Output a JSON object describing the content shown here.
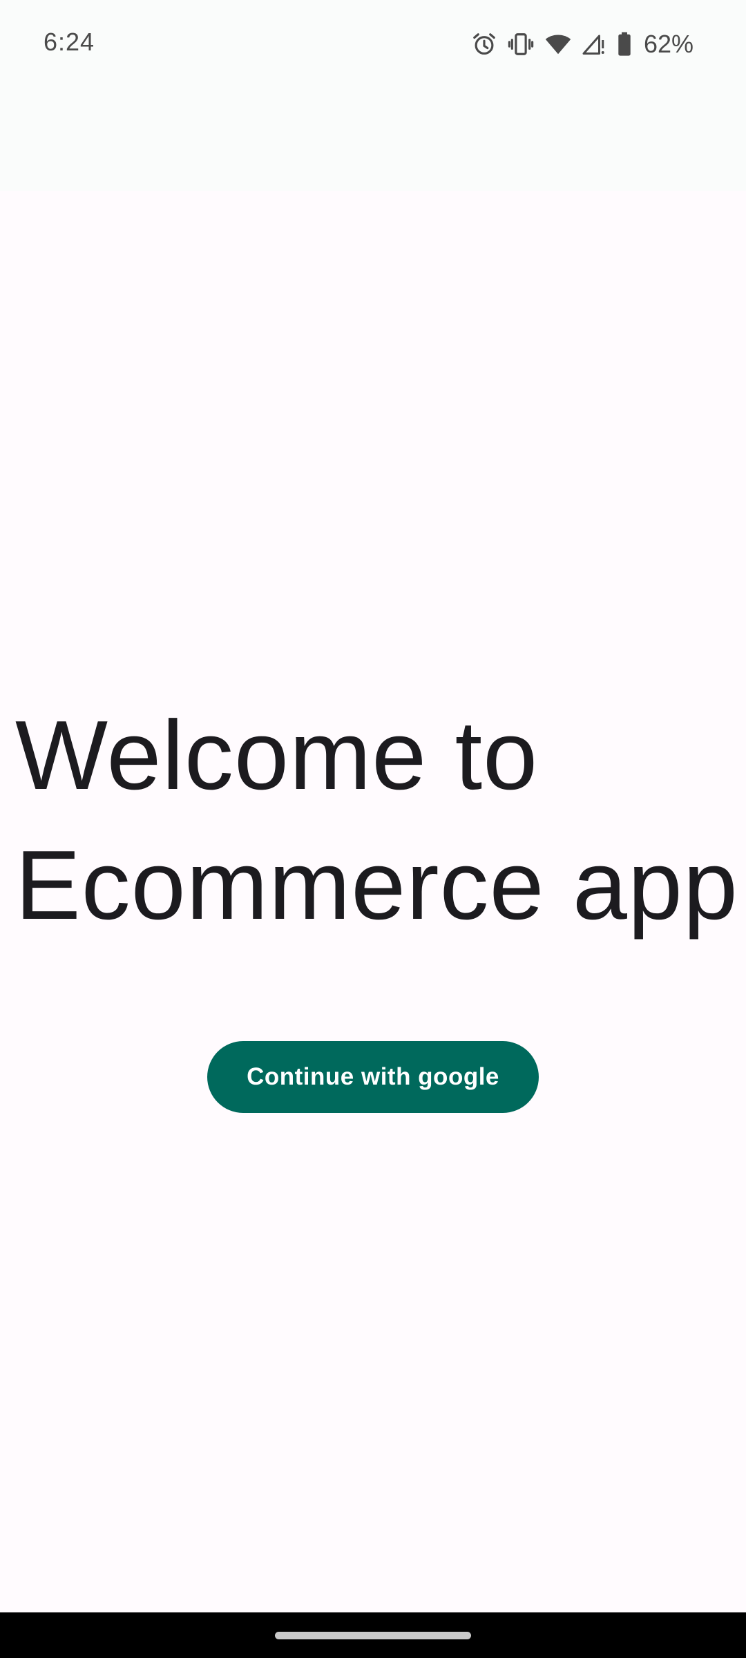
{
  "status_bar": {
    "time": "6:24",
    "battery_percent": "62%",
    "icons": [
      "alarm-icon",
      "vibrate-icon",
      "wifi-icon",
      "cell-signal-icon",
      "battery-icon"
    ]
  },
  "welcome": {
    "line1": "Welcome to",
    "line2": "Ecommerce app"
  },
  "actions": {
    "google_label": "Continue with google"
  },
  "colors": {
    "background": "#fffbfe",
    "button": "#00695c",
    "button_text": "#ffffff",
    "title_text": "#1c1b1f"
  }
}
